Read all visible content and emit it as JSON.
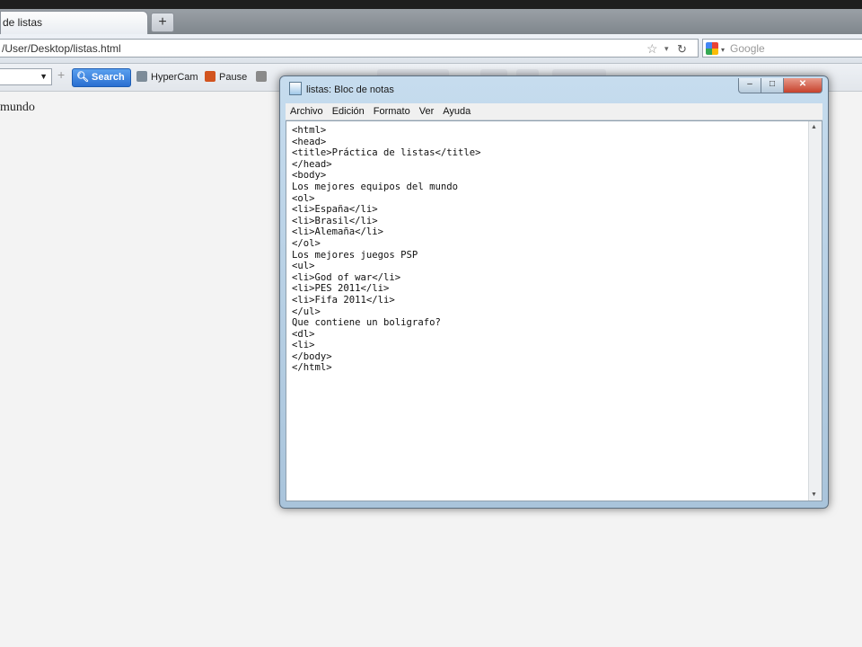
{
  "browser": {
    "tab_title": "de listas",
    "new_tab_label": "+",
    "url": "/User/Desktop/listas.html",
    "google_placeholder": "Google",
    "toolbar": {
      "search_label": "Search",
      "hypercam_label": "HyperCam",
      "pause_label": "Pause"
    }
  },
  "page": {
    "visible_text": "mundo"
  },
  "notepad": {
    "title": "listas: Bloc de notas",
    "menu": [
      "Archivo",
      "Edición",
      "Formato",
      "Ver",
      "Ayuda"
    ],
    "lines": [
      "<html>",
      "<head>",
      "<title>Práctica de listas</title>",
      "</head>",
      "<body>",
      "Los mejores equipos del mundo",
      "<ol>",
      "<li>España</li>",
      "<li>Brasil</li>",
      "<li>Alemaña</li>",
      "</ol>",
      "Los mejores juegos PSP",
      "<ul>",
      "<li>God of war</li>",
      "<li>PES 2011</li>",
      "<li>Fifa 2011</li>",
      "</ul>",
      "Que contiene un boligrafo?",
      "<dl>",
      "<li>",
      "</body>",
      "</html>"
    ]
  },
  "icons": {
    "close_glyph": "✕",
    "maximize_glyph": "□",
    "minimize_glyph": "–"
  }
}
